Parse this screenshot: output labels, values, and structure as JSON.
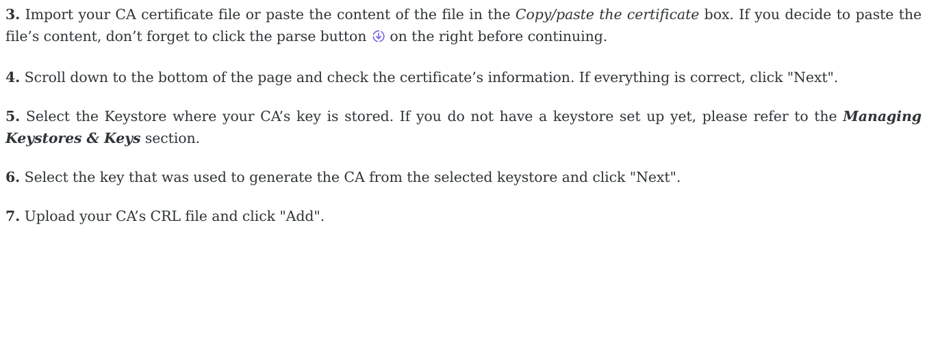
{
  "steps": [
    {
      "num": "3.",
      "t1": " Import your CA certificate file or paste the content of the file in the ",
      "em": "Copy/paste the certificate",
      "t2": " box. If you decide to paste the file’s content, don’t forget to click the parse button",
      "t3": "on the right before continuing."
    },
    {
      "num": "4.",
      "text": " Scroll down to the bottom of the page and check the certificate’s information. If everything is correct, click \"Next\"."
    },
    {
      "num": "5.",
      "t1": " Select the Keystore where your CA’s key is stored. If you do not have a keystore set up yet, please refer to the ",
      "strong": "Managing Keystores & Keys",
      "t2": " section."
    },
    {
      "num": "6.",
      "text": " Select the key that was used to generate the CA from the selected keystore and click \"Next\"."
    },
    {
      "num": "7.",
      "text": " Upload your CA’s CRL file and click \"Add\"."
    }
  ],
  "icons": {
    "parse": "parse-icon",
    "accent_color": "#6f5fe0"
  }
}
